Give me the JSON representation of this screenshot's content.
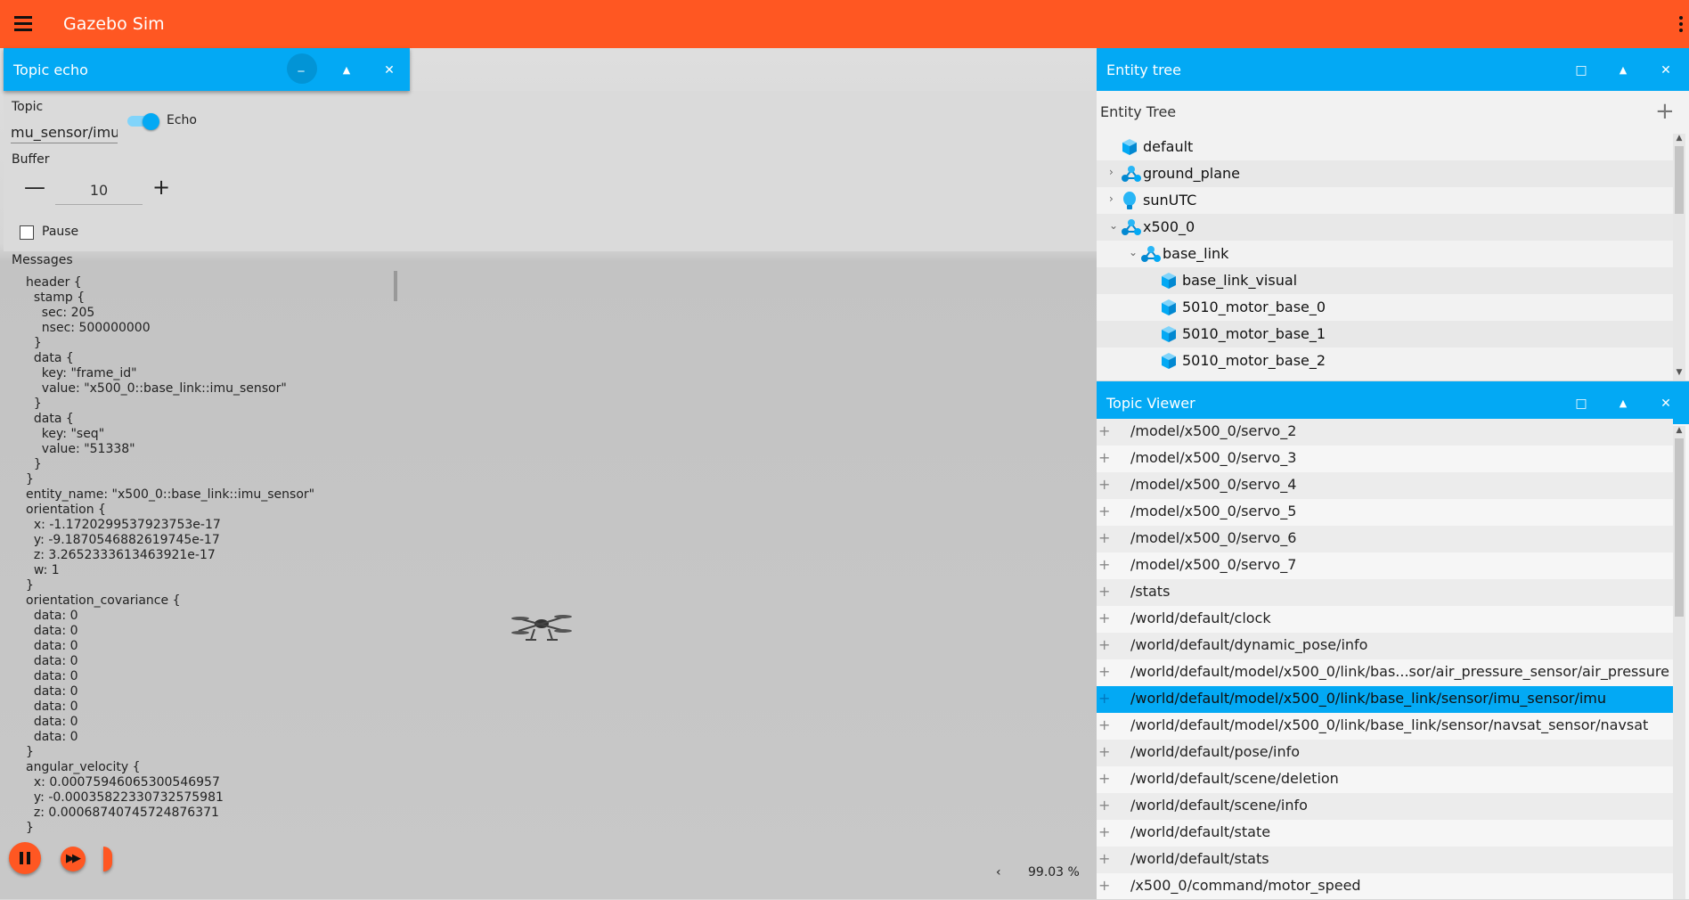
{
  "app": {
    "title": "Gazebo Sim"
  },
  "topic_echo": {
    "panel_title": "Topic echo",
    "topic_label": "Topic",
    "topic_value": "mu_sensor/imu",
    "echo_label": "Echo",
    "buffer_label": "Buffer",
    "buffer_value": "10",
    "minus": "—",
    "plus": "+",
    "pause_label": "Pause",
    "messages_label": "Messages",
    "messages": [
      "header {",
      "  stamp {",
      "    sec: 205",
      "    nsec: 500000000",
      "  }",
      "  data {",
      "    key: \"frame_id\"",
      "    value: \"x500_0::base_link::imu_sensor\"",
      "  }",
      "  data {",
      "    key: \"seq\"",
      "    value: \"51338\"",
      "  }",
      "}",
      "entity_name: \"x500_0::base_link::imu_sensor\"",
      "orientation {",
      "  x: -1.1720299537923753e-17",
      "  y: -9.1870546882619745e-17",
      "  z: 3.2652333613463921e-17",
      "  w: 1",
      "}",
      "orientation_covariance {",
      "  data: 0",
      "  data: 0",
      "  data: 0",
      "  data: 0",
      "  data: 0",
      "  data: 0",
      "  data: 0",
      "  data: 0",
      "  data: 0",
      "}",
      "angular_velocity {",
      "  x: 0.00075946065300546957",
      "  y: -0.00035822330732575981",
      "  z: 0.00068740745724876371",
      "}"
    ]
  },
  "header_buttons": {
    "minimize": "_",
    "maximize": "□",
    "float": "▲",
    "close": "✕"
  },
  "status": {
    "rtf": "99.03 %",
    "chevron": "‹"
  },
  "entity_tree": {
    "panel_title": "Entity tree",
    "title": "Entity Tree",
    "add": "+",
    "items": [
      {
        "label": "default",
        "icon": "world-icon",
        "indent": 0,
        "chevron": ""
      },
      {
        "label": "ground_plane",
        "icon": "model-icon",
        "indent": 0,
        "chevron": "›"
      },
      {
        "label": "sunUTC",
        "icon": "light-icon",
        "indent": 0,
        "chevron": "›"
      },
      {
        "label": "x500_0",
        "icon": "model-icon",
        "indent": 0,
        "chevron": "⌄"
      },
      {
        "label": "base_link",
        "icon": "link-icon",
        "indent": 1,
        "chevron": "⌄"
      },
      {
        "label": "base_link_visual",
        "icon": "visual-icon",
        "indent": 2,
        "chevron": ""
      },
      {
        "label": "5010_motor_base_0",
        "icon": "visual-icon",
        "indent": 2,
        "chevron": ""
      },
      {
        "label": "5010_motor_base_1",
        "icon": "visual-icon",
        "indent": 2,
        "chevron": ""
      },
      {
        "label": "5010_motor_base_2",
        "icon": "visual-icon",
        "indent": 2,
        "chevron": ""
      }
    ]
  },
  "topic_viewer": {
    "panel_title": "Topic Viewer",
    "plus": "+",
    "selected": "/world/default/model/x500_0/link/base_link/sensor/imu_sensor/imu",
    "topics": [
      "/model/x500_0/servo_2",
      "/model/x500_0/servo_3",
      "/model/x500_0/servo_4",
      "/model/x500_0/servo_5",
      "/model/x500_0/servo_6",
      "/model/x500_0/servo_7",
      "/stats",
      "/world/default/clock",
      "/world/default/dynamic_pose/info",
      "/world/default/model/x500_0/link/bas...sor/air_pressure_sensor/air_pressure",
      "/world/default/model/x500_0/link/base_link/sensor/imu_sensor/imu",
      "/world/default/model/x500_0/link/base_link/sensor/navsat_sensor/navsat",
      "/world/default/pose/info",
      "/world/default/scene/deletion",
      "/world/default/scene/info",
      "/world/default/state",
      "/world/default/stats",
      "/x500_0/command/motor_speed"
    ]
  },
  "colors": {
    "accent": "#ff5722",
    "panel": "#03a9f4",
    "icon_blue": "#29b6f6"
  }
}
